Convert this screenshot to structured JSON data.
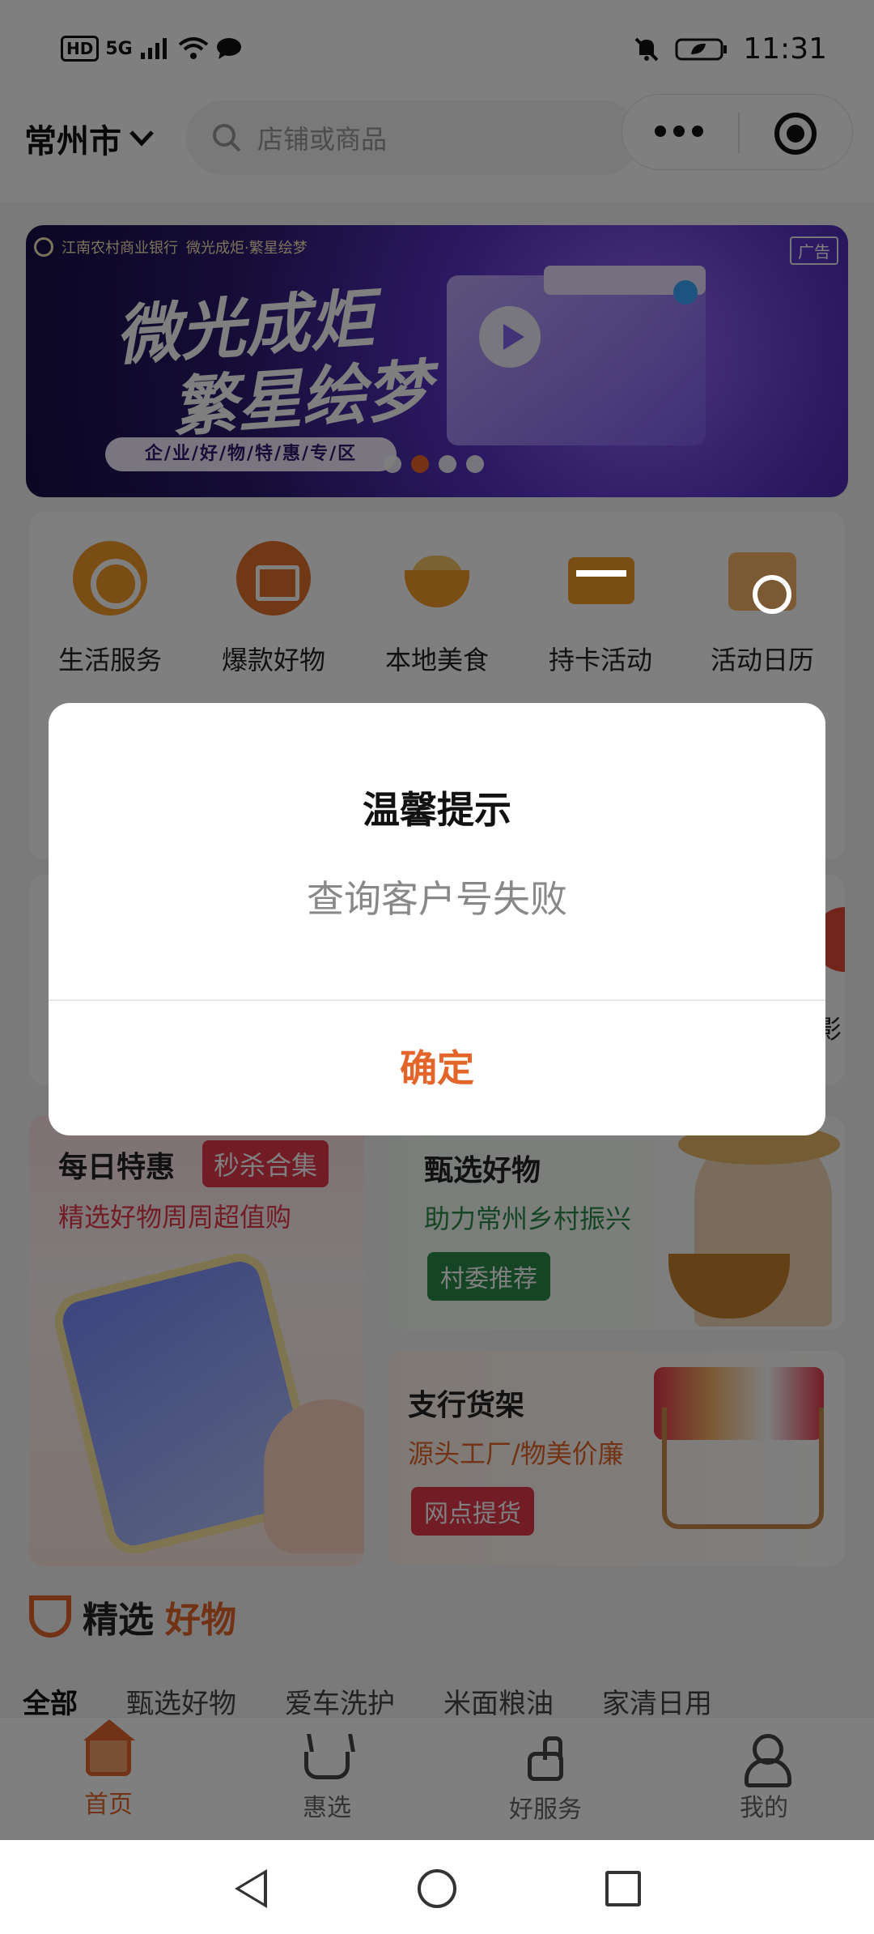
{
  "status_bar": {
    "hd": "HD",
    "network": "5G",
    "time": "11:31"
  },
  "header": {
    "city": "常州市",
    "search_placeholder": "店铺或商品"
  },
  "banner": {
    "bank_name": "江南农村商业银行",
    "campaign": "微光成炬·繁星绘梦",
    "calligraphy_line1": "微光成炬",
    "calligraphy_line2": "繁星绘梦",
    "pill": "企/业/好/物/特/惠/专/区",
    "ad_label": "广告"
  },
  "categories": [
    {
      "label": "生活服务",
      "icon": "coin-icon"
    },
    {
      "label": "爆款好物",
      "icon": "shop-icon"
    },
    {
      "label": "本地美食",
      "icon": "food-bowl-icon"
    },
    {
      "label": "持卡活动",
      "icon": "card-icon"
    },
    {
      "label": "活动日历",
      "icon": "calendar-icon"
    }
  ],
  "partial_row": {
    "right_edge_text": "影"
  },
  "promos": {
    "daily": {
      "title": "每日特惠",
      "tag": "秒杀合集",
      "subtitle": "精选好物周周超值购"
    },
    "selected": {
      "title": "甄选好物",
      "subtitle": "助力常州乡村振兴",
      "tag": "村委推荐"
    },
    "branch": {
      "title": "支行货架",
      "subtitle": "源头工厂/物美价廉",
      "tag": "网点提货"
    }
  },
  "section": {
    "title_a": "精选",
    "title_b": "好物"
  },
  "filters": [
    "全部",
    "甄选好物",
    "爱车洗护",
    "米面粮油",
    "家清日用"
  ],
  "tabs": [
    {
      "label": "首页",
      "active": true
    },
    {
      "label": "惠选",
      "active": false
    },
    {
      "label": "好服务",
      "active": false
    },
    {
      "label": "我的",
      "active": false
    }
  ],
  "dialog": {
    "title": "温馨提示",
    "message": "查询客户号失败",
    "confirm": "确定"
  },
  "colors": {
    "accent": "#e4652a",
    "red": "#e4384a",
    "green": "#2b8a4a"
  }
}
